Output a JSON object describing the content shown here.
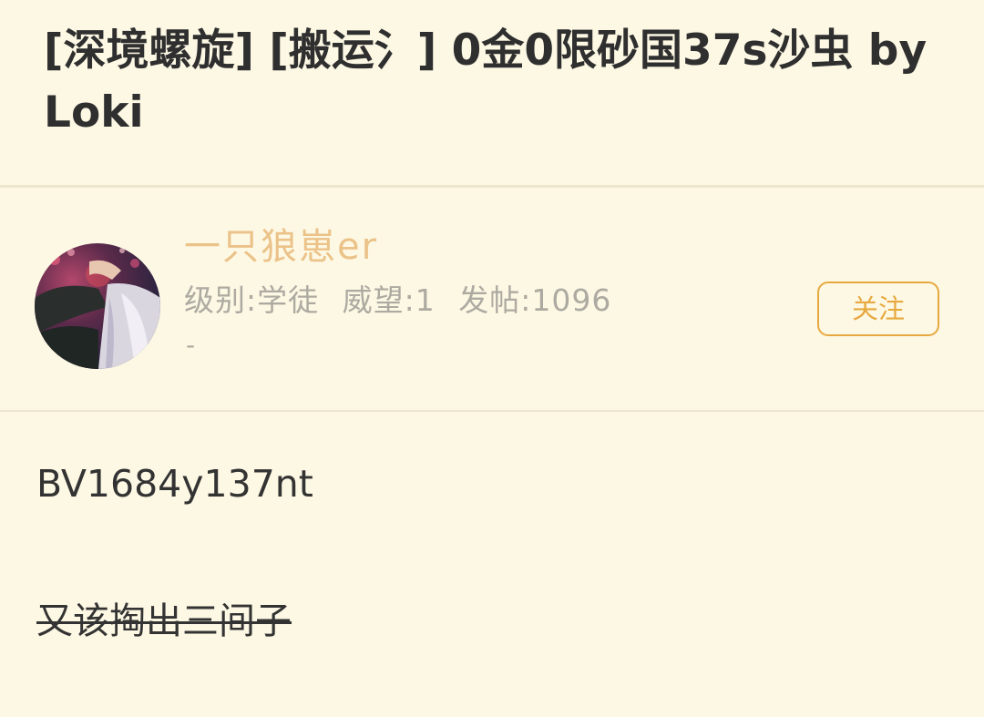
{
  "post": {
    "title": "[深境螺旋] [搬运氵] 0金0限砂国37s沙虫 by Loki"
  },
  "author": {
    "name": "一只狼崽er",
    "level": "级别:学徒",
    "prestige": "威望:1",
    "posts": "发帖:1096",
    "signature": "-",
    "follow_label": "关注"
  },
  "content": {
    "bv_code": "BV1684y137nt",
    "strikethrough_text": "又该掏出三间子"
  },
  "colors": {
    "background": "#fdf8e4",
    "title_text": "#2f2f2f",
    "author_name": "#ebc288",
    "meta_text": "#adaaa1",
    "accent": "#e7a93f",
    "divider": "#ece6cf"
  }
}
